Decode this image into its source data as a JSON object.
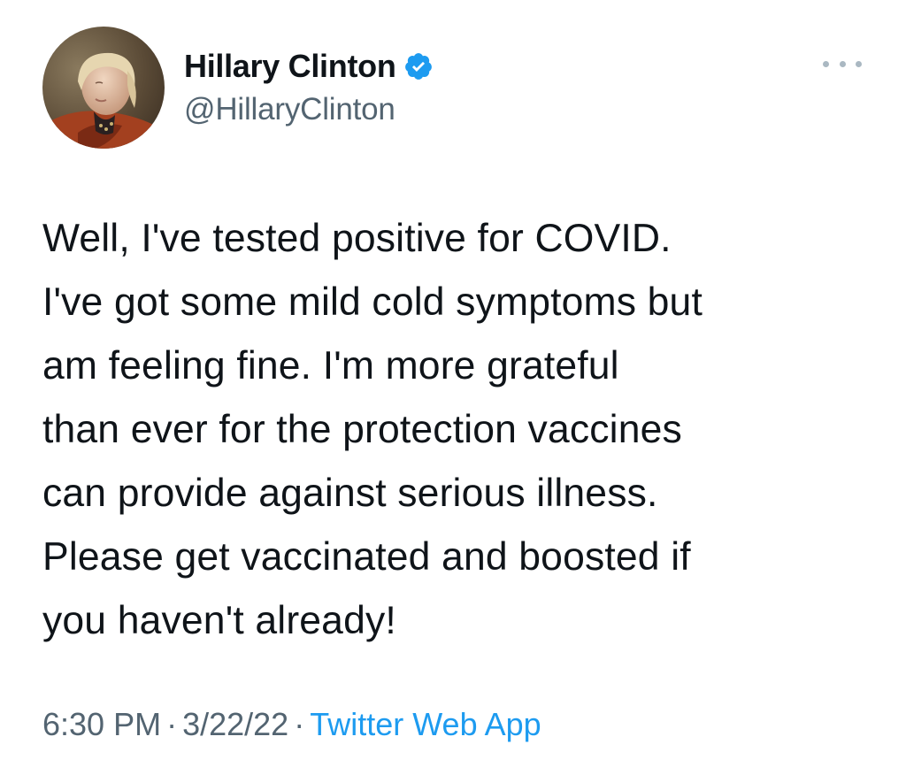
{
  "author": {
    "display_name": "Hillary Clinton",
    "handle": "@HillaryClinton",
    "verified": true,
    "verified_icon": "verified-badge-icon",
    "verified_color": "#1d9bf0"
  },
  "tweet": {
    "lines": [
      "Well, I've tested positive for COVID.",
      "I've got some mild cold symptoms but",
      "am feeling fine. I'm more grateful",
      "than ever for the protection vaccines",
      "can provide against serious illness.",
      "Please get vaccinated and boosted if",
      "you haven't already!"
    ]
  },
  "meta": {
    "time": "6:30 PM",
    "separator": "·",
    "date": "3/22/22",
    "source": "Twitter Web App"
  },
  "icons": {
    "more": "more-options-icon"
  },
  "colors": {
    "text": "#0f1419",
    "secondary": "#536471",
    "link": "#1d9bf0"
  }
}
